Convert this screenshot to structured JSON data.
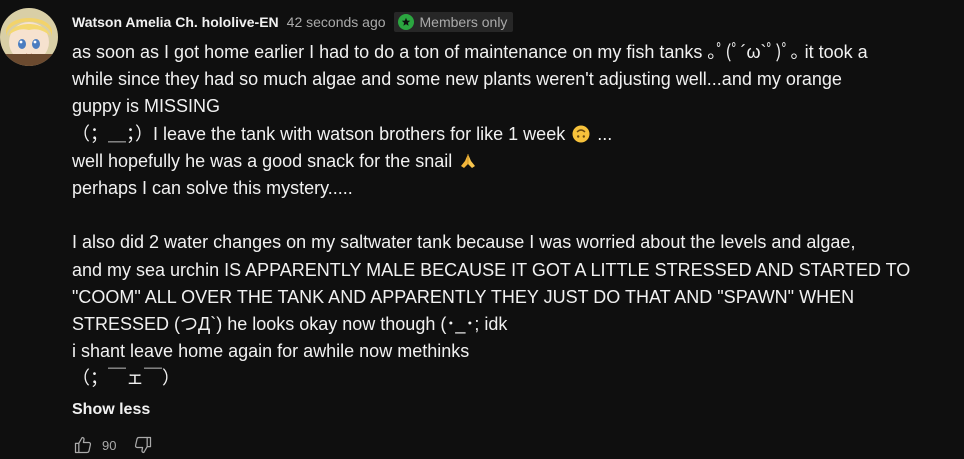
{
  "comment": {
    "author": "Watson Amelia Ch. hololive-EN",
    "timestamp": "42 seconds ago",
    "badge": "Members only",
    "lines": [
      "as soon as I got home earlier I had to do a ton of maintenance on my fish tanks ｡ﾟ(ﾟ´ω`ﾟ)ﾟ｡ it took a",
      "while since they had so much algae and some new plants weren't adjusting well...and my orange",
      "guppy is MISSING",
      "（；＿；）I leave the tank with watson brothers for like 1 week",
      "well hopefully he was a good snack for the snail",
      "perhaps I can solve this mystery.....",
      "",
      "I also did 2 water changes on my saltwater tank because I was worried about the levels and algae,",
      "and my sea urchin IS APPARENTLY MALE BECAUSE IT GOT A LITTLE STRESSED AND STARTED TO",
      "\"COOM\" ALL OVER THE TANK AND APPARENTLY THEY JUST DO THAT AND \"SPAWN\" WHEN",
      "STRESSED (つД`) he looks okay now though (･_･; idk",
      "i shant leave home again for awhile now methinks",
      "（；￣ェ￣）"
    ],
    "line4_suffix": " ...",
    "show_less": "Show less",
    "like_count": "90"
  },
  "icons": {
    "avatar": "avatar-image",
    "badge": "member-badge-icon",
    "upside_down_emoji": "upside-down-face-emoji",
    "pray_emoji": "folded-hands-emoji",
    "like": "thumbs-up-icon",
    "dislike": "thumbs-down-icon"
  },
  "colors": {
    "background": "#0f0f0f",
    "text": "#f1f1f1",
    "secondary_text": "#aaaaaa",
    "badge_bg": "#272727",
    "badge_icon": "#2ba640"
  }
}
